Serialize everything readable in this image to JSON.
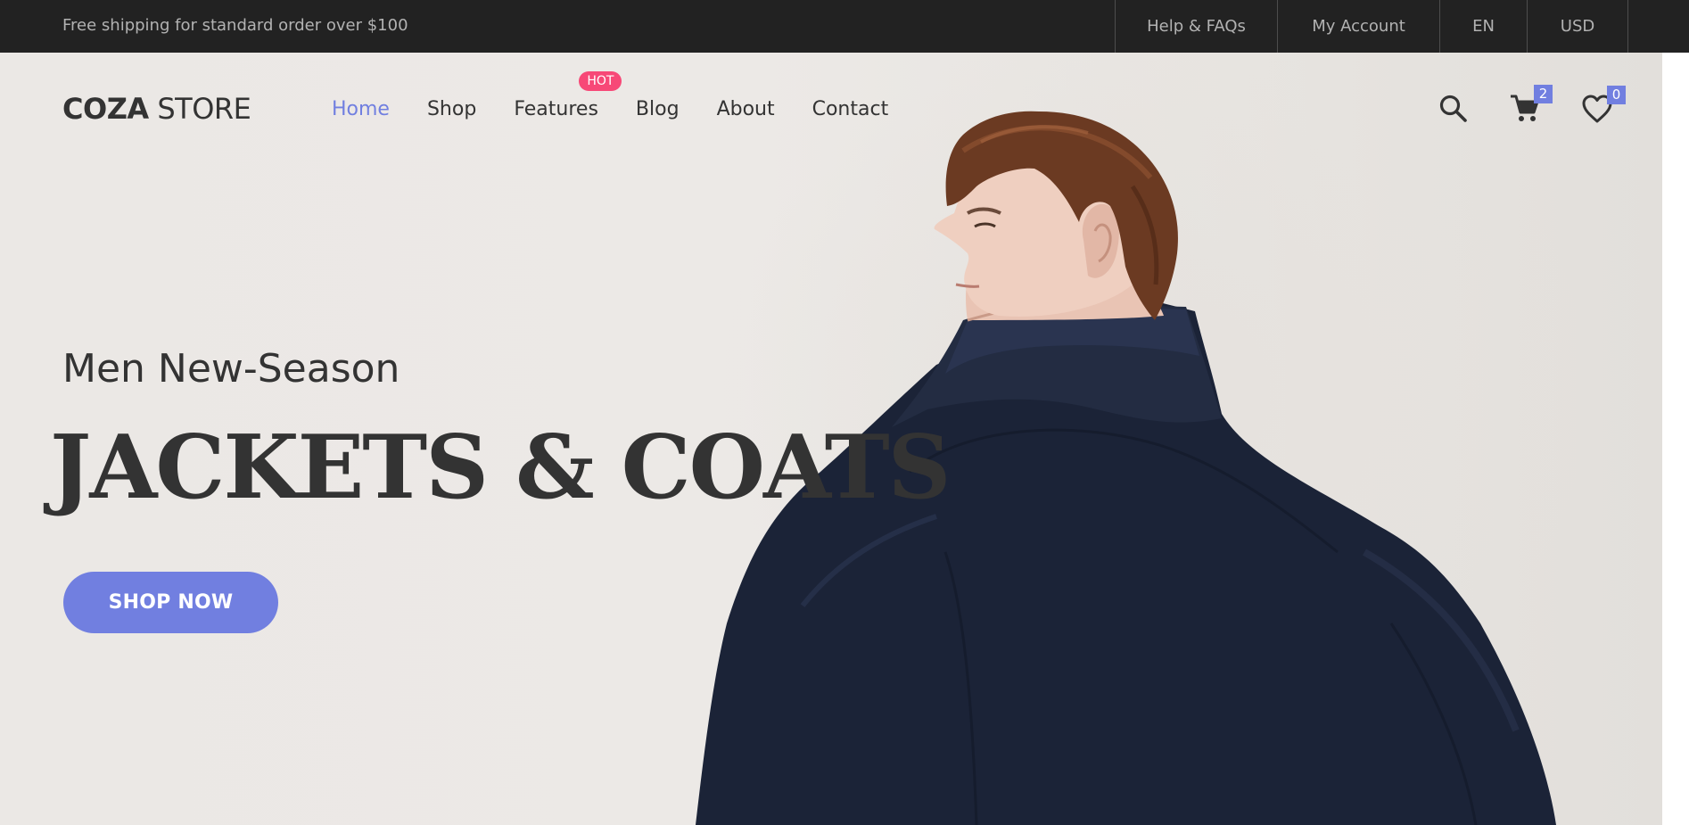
{
  "topbar": {
    "promo": "Free shipping for standard order over $100",
    "help": "Help & FAQs",
    "account": "My Account",
    "language": "EN",
    "currency": "USD"
  },
  "header": {
    "logo_bold": "COZA",
    "logo_light": " STORE",
    "nav": [
      {
        "label": "Home",
        "active": true
      },
      {
        "label": "Shop"
      },
      {
        "label": "Features",
        "badge": "HOT"
      },
      {
        "label": "Blog"
      },
      {
        "label": "About"
      },
      {
        "label": "Contact"
      }
    ],
    "icons": {
      "search": "search-icon",
      "cart": "cart-icon",
      "wishlist": "heart-icon"
    },
    "cart_count": "2",
    "wishlist_count": "0"
  },
  "hero": {
    "subtitle": "Men New-Season",
    "headline": "JACKETS & COATS",
    "cta": "SHOP NOW"
  },
  "colors": {
    "accent": "#717fe0",
    "hot_badge": "#f74877",
    "topbar_bg": "#222222",
    "text_dark": "#333333"
  }
}
